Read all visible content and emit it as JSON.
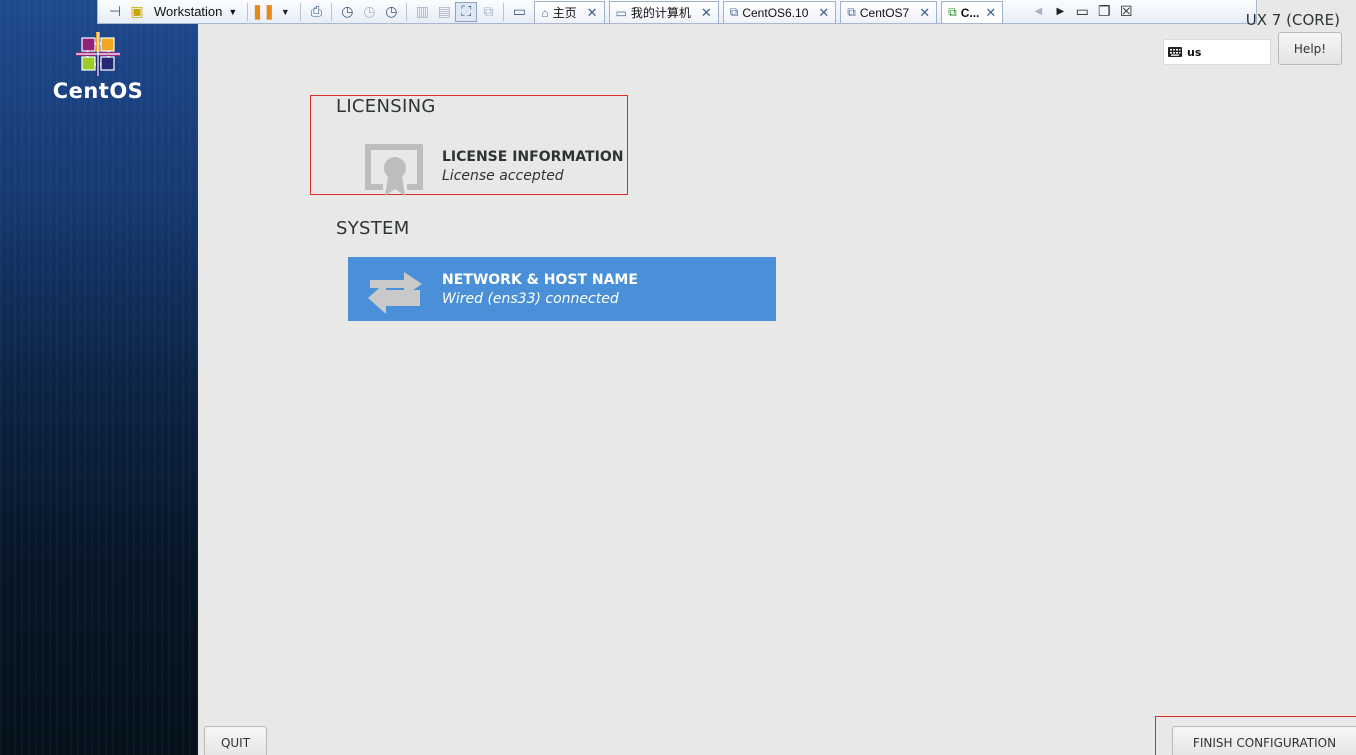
{
  "vm_toolbar": {
    "workstation_label": "Workstation",
    "tabs": [
      {
        "label": "主页",
        "icon": "home-icon"
      },
      {
        "label": "我的计算机",
        "icon": "computer-icon"
      },
      {
        "label": "CentOS6.10",
        "icon": "vm-icon"
      },
      {
        "label": "CentOS7",
        "icon": "vm-icon"
      },
      {
        "label": "C...",
        "icon": "vm-running-icon"
      }
    ],
    "close_glyph": "✕"
  },
  "sidebar": {
    "logo_text": "CentOS"
  },
  "header": {
    "product_title": "UX 7 (CORE)",
    "keyboard_layout": "us",
    "help_label": "Help!"
  },
  "licensing": {
    "heading": "LICENSING",
    "spoke_title": "LICENSE INFORMATION",
    "spoke_status": "License accepted"
  },
  "system": {
    "heading": "SYSTEM",
    "spoke_title": "NETWORK & HOST NAME",
    "spoke_status": "Wired (ens33) connected"
  },
  "footer": {
    "quit_label": "QUIT",
    "finish_label": "FINISH CONFIGURATION"
  },
  "colors": {
    "selected_spoke": "#4a90d9",
    "highlight_border": "#d9302a"
  }
}
